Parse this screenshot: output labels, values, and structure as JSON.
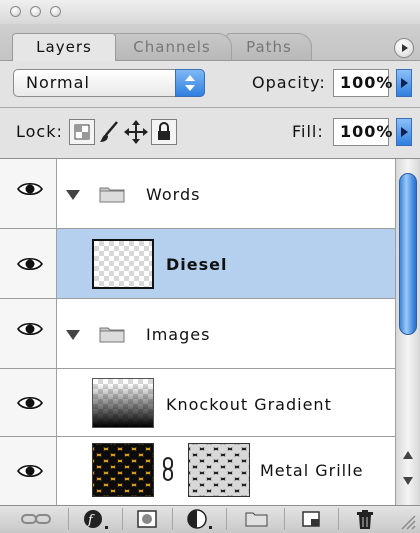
{
  "window": {
    "traffic_lights": [
      "close-button",
      "minimize-button",
      "zoom-button"
    ]
  },
  "tabs": [
    {
      "label": "Layers",
      "active": true
    },
    {
      "label": "Channels",
      "active": false
    },
    {
      "label": "Paths",
      "active": false
    }
  ],
  "blend": {
    "mode": "Normal",
    "opacity_label": "Opacity:",
    "opacity_value": "100%"
  },
  "lock": {
    "label": "Lock:",
    "fill_label": "Fill:",
    "fill_value": "100%"
  },
  "layers": [
    {
      "name": "Words",
      "type": "group",
      "visible": true,
      "selected": false
    },
    {
      "name": "Diesel",
      "type": "layer",
      "visible": true,
      "selected": true
    },
    {
      "name": "Images",
      "type": "group",
      "visible": true,
      "selected": false
    },
    {
      "name": "Knockout Gradient",
      "type": "layer",
      "visible": true,
      "selected": false
    },
    {
      "name": "Metal Grille",
      "type": "layer-with-mask",
      "visible": true,
      "selected": false
    }
  ],
  "colors": {
    "selection": "#b5d0ee",
    "accent": "#2f7fe0"
  },
  "bottom_buttons": [
    "link-layers-icon",
    "layer-style-icon",
    "add-mask-icon",
    "adjustment-layer-icon",
    "new-group-icon",
    "new-layer-icon",
    "trash-icon"
  ]
}
